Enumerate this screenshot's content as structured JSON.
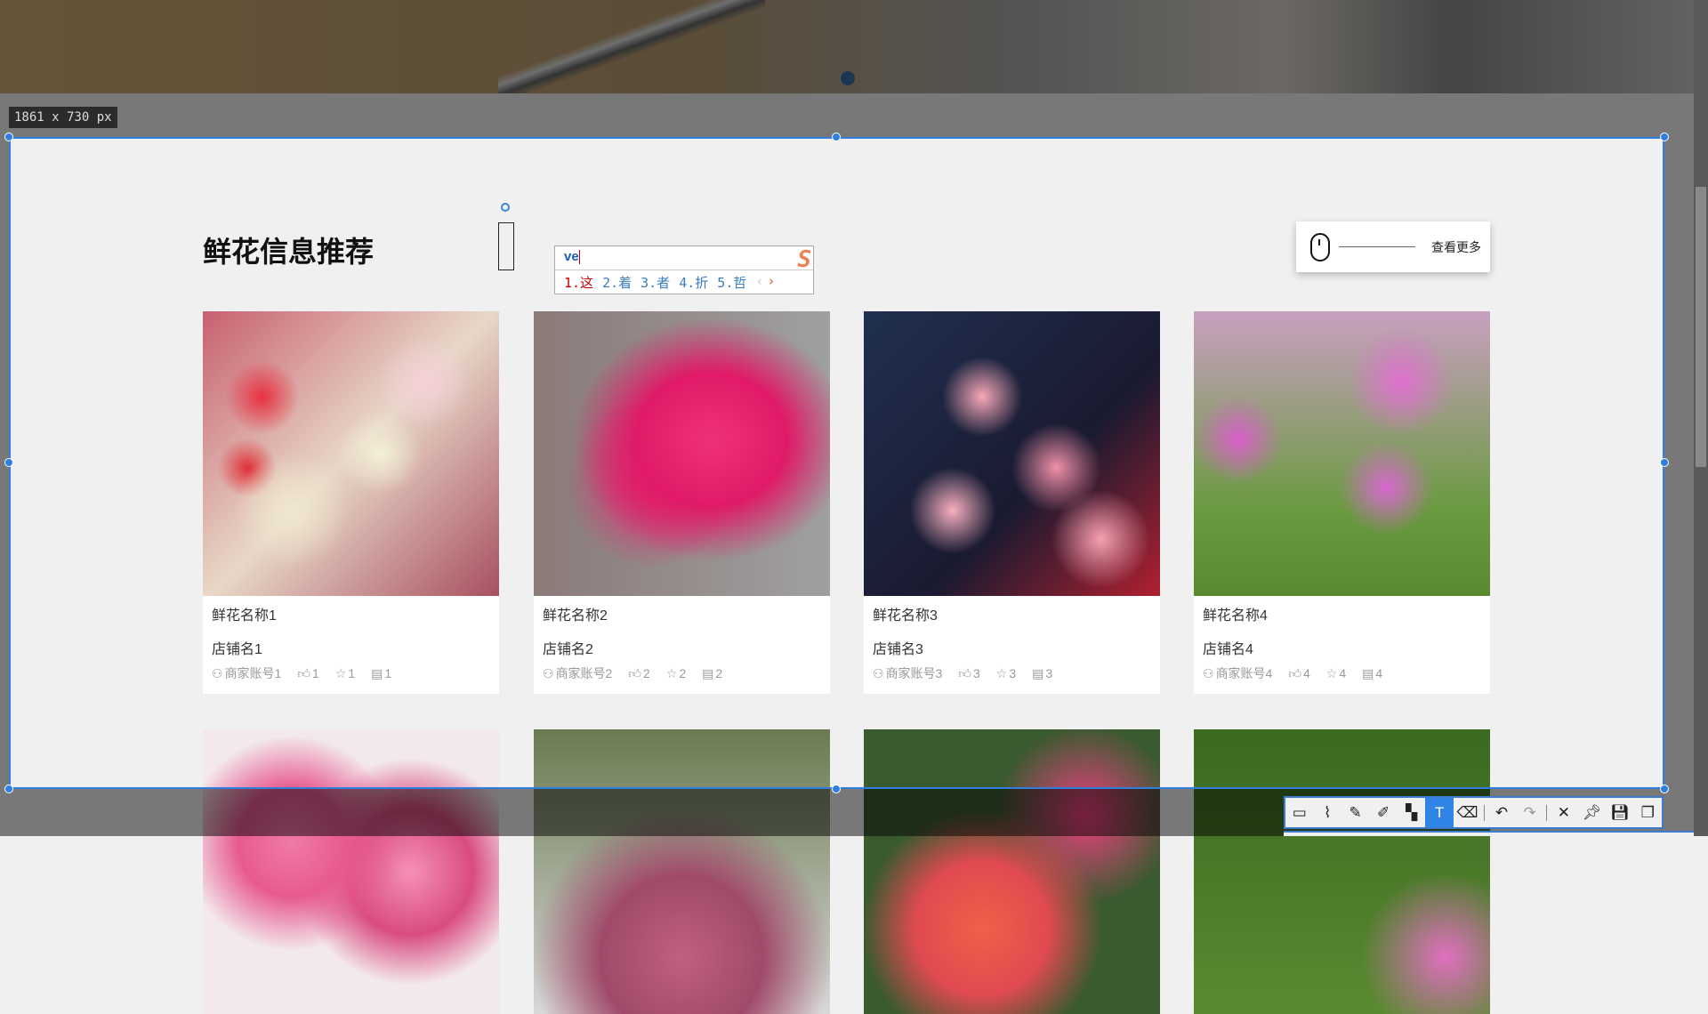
{
  "section": {
    "title": "鲜花信息推荐",
    "more_label": "查看更多"
  },
  "cards": [
    {
      "name": "鲜花名称1",
      "shop": "店铺名1",
      "account": "商家账号1",
      "likes": "1",
      "favorites": "1",
      "comments": "1"
    },
    {
      "name": "鲜花名称2",
      "shop": "店铺名2",
      "account": "商家账号2",
      "likes": "2",
      "favorites": "2",
      "comments": "2"
    },
    {
      "name": "鲜花名称3",
      "shop": "店铺名3",
      "account": "商家账号3",
      "likes": "3",
      "favorites": "3",
      "comments": "3"
    },
    {
      "name": "鲜花名称4",
      "shop": "店铺名4",
      "account": "商家账号4",
      "likes": "4",
      "favorites": "4",
      "comments": "4"
    }
  ],
  "ime": {
    "input": "ve",
    "candidates": [
      "1.这",
      "2.着",
      "3.者",
      "4.折",
      "5.哲"
    ],
    "logo": "S"
  },
  "screenshot_tool": {
    "size_label": "1861 x 730 px",
    "tools": [
      "rectangle-ellipse",
      "polyline",
      "pen",
      "highlighter",
      "mosaic",
      "text",
      "eraser",
      "undo",
      "redo",
      "close",
      "pin",
      "save",
      "copy"
    ],
    "active_tool": "text",
    "accent": "#2f7ee0"
  }
}
